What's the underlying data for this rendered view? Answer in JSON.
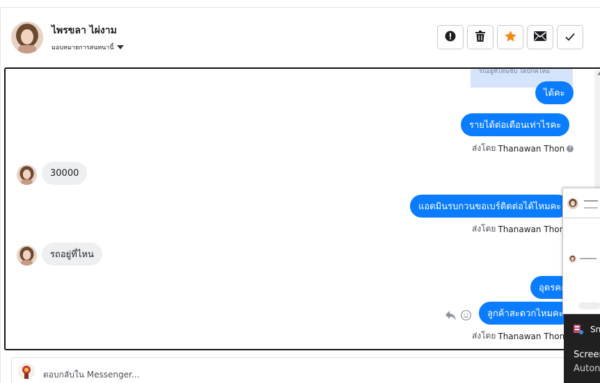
{
  "header": {
    "name": "ไพรขลา ไผ่งาม",
    "assign_label": "มอบหมายการสนทนานี้",
    "actions": [
      {
        "name": "spam-icon",
        "label": "!"
      },
      {
        "name": "trash-icon",
        "label": ""
      },
      {
        "name": "star-icon",
        "label": ""
      },
      {
        "name": "mail-icon",
        "label": ""
      },
      {
        "name": "check-icon",
        "label": ""
      }
    ]
  },
  "conversation": {
    "hint_text": "รถอยู่ที่ไหนขับ ได้บักคไหม",
    "messages": {
      "m1": "ได้คะ",
      "m2": "รายได้ต่อเดือนเท่าไรคะ",
      "m3": "30000",
      "m4": "แอดมินรบกวนขอเบร์ติดต่อได้ไหมคะ",
      "m5": "รถอยู่ที่ไหน",
      "m6": "อุดรคะ",
      "m7": "ลูกค้าสะดวกไหมคะ"
    },
    "sent_by_prefix": "ส่งโดย",
    "sent_by_name": "Thanawan Thon",
    "help_icon": "?"
  },
  "reply": {
    "placeholder": "ตอบกลับใน Messenger..."
  },
  "overlay": {
    "snip_label": "Sn",
    "line1": "Screer",
    "line2": "Auton"
  },
  "colors": {
    "outgoing_bubble": "#0a7cff",
    "incoming_bubble": "#eeeff1",
    "star": "#f28b1a"
  }
}
